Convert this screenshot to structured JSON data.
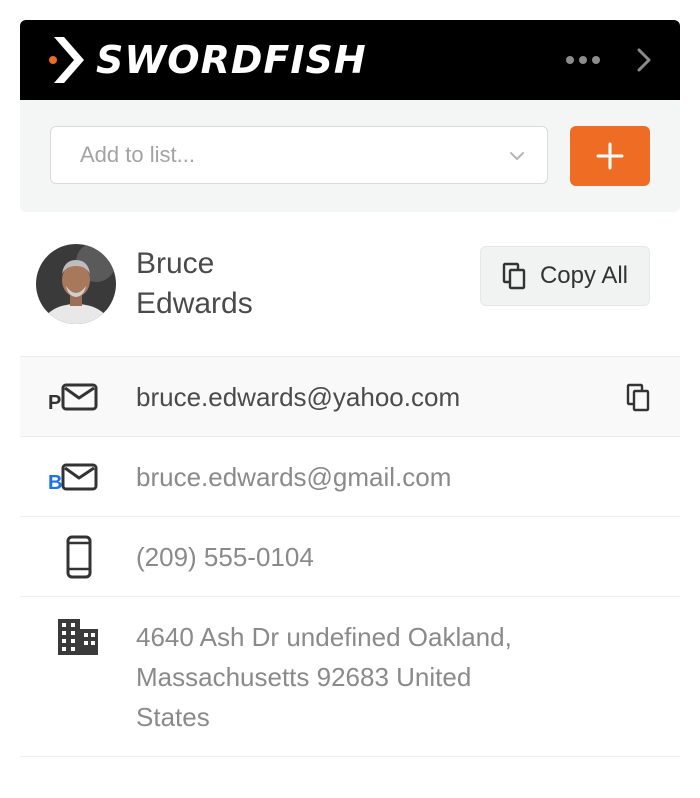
{
  "header": {
    "brand": "SWORDFISH",
    "brand_color": "#ee6c24",
    "more_icon": "more-horizontal-icon",
    "next_icon": "chevron-right-icon"
  },
  "list_bar": {
    "placeholder": "Add to list...",
    "dropdown_icon": "chevron-down-icon",
    "add_icon": "plus-icon",
    "add_color": "#ee6c24"
  },
  "contact": {
    "first_name": "Bruce",
    "last_name": "Edwards",
    "copy_all_label": "Copy All",
    "copy_icon": "copy-icon"
  },
  "details": [
    {
      "type": "personal-email",
      "icon": "personal-email-icon",
      "badge": "P",
      "value": "bruce.edwards@yahoo.com",
      "highlighted": true
    },
    {
      "type": "business-email",
      "icon": "business-email-icon",
      "badge": "B",
      "badge_color": "#1a73e8",
      "value": "bruce.edwards@gmail.com"
    },
    {
      "type": "phone",
      "icon": "mobile-phone-icon",
      "value": "(209) 555-0104"
    },
    {
      "type": "address",
      "icon": "building-icon",
      "lines": [
        "4640 Ash Dr undefined Oakland,",
        "Massachusetts 92683 United",
        "States"
      ]
    }
  ]
}
